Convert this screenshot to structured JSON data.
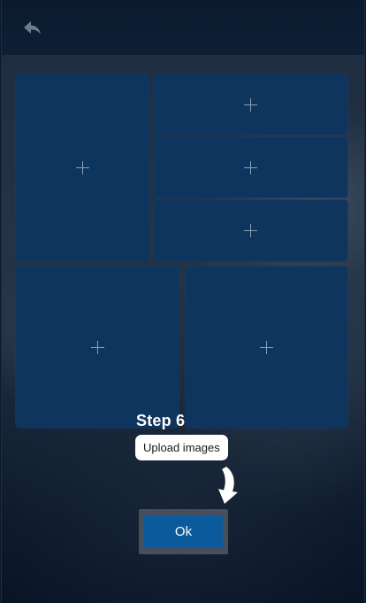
{
  "header": {
    "back_icon": "back-arrow-icon"
  },
  "grid": {
    "tiles": [
      {
        "id": "tile-1",
        "icon": "plus-icon"
      },
      {
        "id": "tile-2",
        "icon": "plus-icon"
      },
      {
        "id": "tile-3",
        "icon": "plus-icon"
      },
      {
        "id": "tile-4",
        "icon": "plus-icon"
      },
      {
        "id": "tile-5",
        "icon": "plus-icon"
      },
      {
        "id": "tile-6",
        "icon": "plus-icon"
      }
    ]
  },
  "tutorial": {
    "step_title": "Step 6",
    "tooltip": "Upload images",
    "arrow_icon": "curved-arrow-down-icon",
    "ok_label": "Ok"
  },
  "colors": {
    "tile_bg": "#0e355d",
    "ok_button_bg": "#0b5a9c",
    "ok_button_frame": "#46505c"
  }
}
